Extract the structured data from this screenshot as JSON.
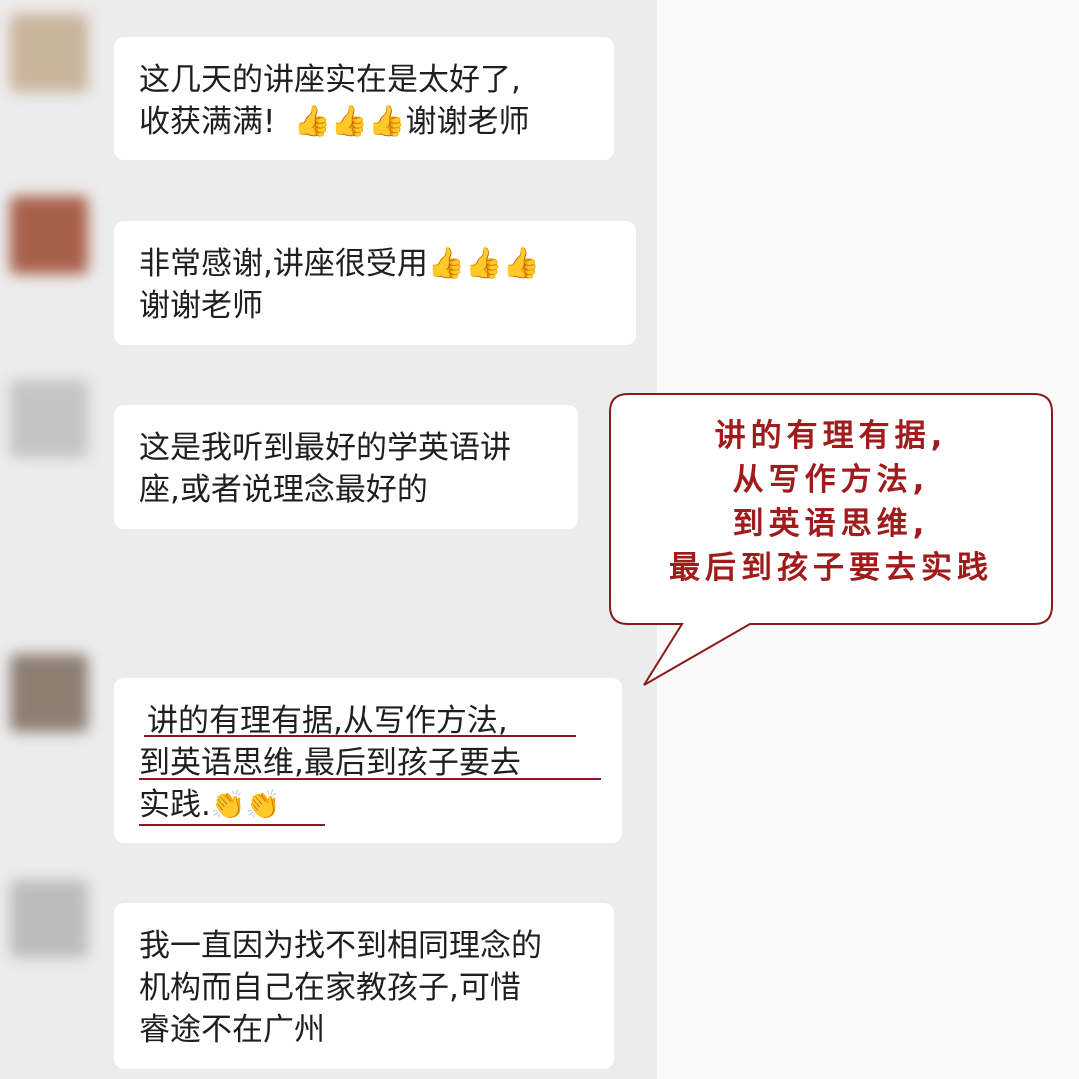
{
  "messages": [
    {
      "avatar_color": "#c9b49c",
      "lines": [
        "这几天的讲座实在是太好了,",
        "收获满满!"
      ],
      "emoji": "👍",
      "emoji_count": 3,
      "suffix": "谢谢老师"
    },
    {
      "avatar_color": "#a9604a",
      "lines": [
        "非常感谢,讲座很受用",
        "谢谢老师"
      ],
      "emoji": "👍",
      "emoji_count": 3
    },
    {
      "avatar_color": "#c4c4c4",
      "lines": [
        "这是我听到最好的学英语讲",
        "座,或者说理念最好的"
      ]
    },
    {
      "avatar_color": "#8c7f72",
      "lines": [
        "讲的有理有据,从写作方法,",
        "到英语思维,最后到孩子要去",
        "实践."
      ],
      "emoji": "👏",
      "emoji_count": 2,
      "underline_color": "#8b1a1a"
    },
    {
      "avatar_color": "#bcbcbc",
      "lines": [
        "我一直因为找不到相同理念的",
        "机构而自己在家教孩子,可惜",
        "睿途不在广州"
      ]
    }
  ],
  "callout": {
    "lines": [
      "讲的有理有据,",
      "从写作方法,",
      "到英语思维,",
      "最后到孩子要去实践"
    ],
    "border_color": "#8b1a1a",
    "text_color": "#a01c1c"
  }
}
